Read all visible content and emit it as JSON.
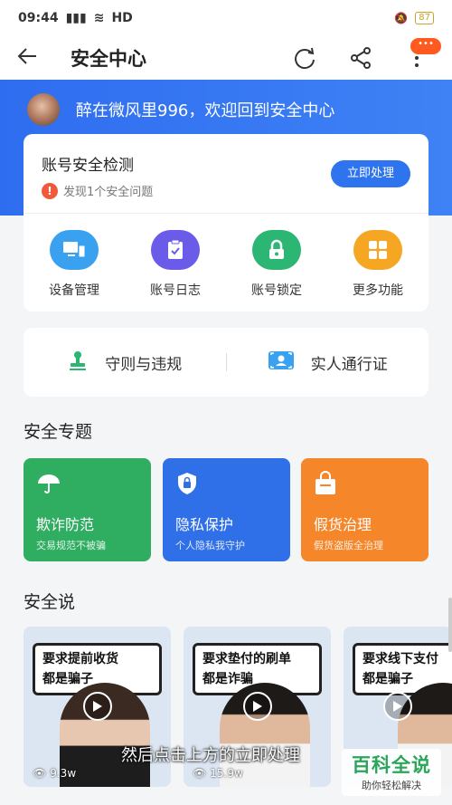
{
  "status": {
    "time": "09:44",
    "network": "HD",
    "battery": "87"
  },
  "header": {
    "title": "安全中心"
  },
  "welcome": {
    "text": "醉在微风里996，欢迎回到安全中心"
  },
  "detect": {
    "title": "账号安全检测",
    "warning": "发现1个安全问题",
    "button": "立即处理"
  },
  "features": [
    {
      "label": "设备管理",
      "icon": "device-icon",
      "color": "#3aa1f0"
    },
    {
      "label": "账号日志",
      "icon": "log-icon",
      "color": "#6a5be8"
    },
    {
      "label": "账号锁定",
      "icon": "lock-icon",
      "color": "#2bb673"
    },
    {
      "label": "更多功能",
      "icon": "grid-icon",
      "color": "#f5a623"
    }
  ],
  "rules": [
    {
      "label": "守则与违规",
      "icon": "stamp-icon"
    },
    {
      "label": "实人通行证",
      "icon": "id-card-icon"
    }
  ],
  "topics_title": "安全专题",
  "topics": [
    {
      "title": "欺诈防范",
      "sub": "交易规范不被骗",
      "icon": "umbrella-icon",
      "color": "#2fae62"
    },
    {
      "title": "隐私保护",
      "sub": "个人隐私我守护",
      "icon": "shield-lock-icon",
      "color": "#2f6fe8"
    },
    {
      "title": "假货治理",
      "sub": "假货盗版全治理",
      "icon": "bag-icon",
      "color": "#f5862a"
    }
  ],
  "talks_title": "安全说",
  "videos": [
    {
      "line1": "要求提前收货",
      "line2": "都是骗子",
      "views": "9.3w"
    },
    {
      "line1": "要求垫付的刷单",
      "line2": "都是诈骗",
      "views": "15.9w"
    },
    {
      "line1": "要求线下支付",
      "line2": "都是骗子",
      "views": ""
    }
  ],
  "caption": "然后点击上方的立即处理",
  "watermark": {
    "main": "百科全说",
    "sub": "助你轻松解决"
  },
  "colors": {
    "primary": "#2d74ee",
    "hero": "#3e82f5",
    "warn": "#ef5a3c"
  }
}
